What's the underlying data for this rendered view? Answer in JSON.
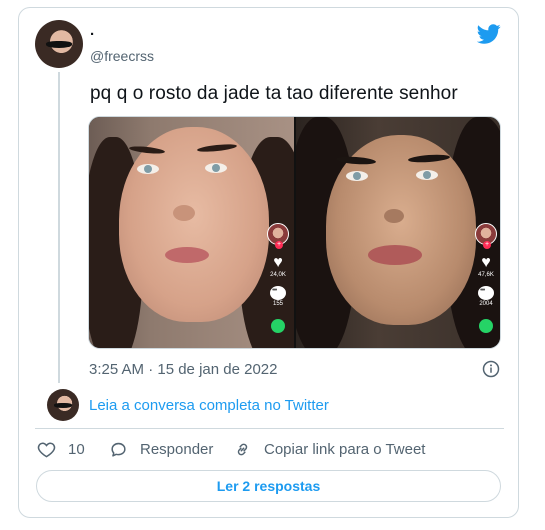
{
  "author": {
    "display_name": ".",
    "handle": "@freecrss"
  },
  "tweet": {
    "text": "pq q o rosto da jade ta tao diferente senhor",
    "timestamp": "3:25 AM · 15 de jan de 2022"
  },
  "media": {
    "left_panel": {
      "likes": "24,0K",
      "comments": "155"
    },
    "right_panel": {
      "likes": "47,6K",
      "comments": "2004"
    }
  },
  "read_conversation": "Leia a conversa completa no Twitter",
  "actions": {
    "like_count": "10",
    "reply_label": "Responder",
    "copy_link_label": "Copiar link para o Tweet"
  },
  "read_replies_button": "Ler 2 respostas",
  "colors": {
    "brand_blue": "#1d9bf0",
    "secondary_text": "#536471",
    "border": "#cfd9de"
  },
  "icons": [
    "twitter-bird-icon",
    "info-icon",
    "heart-icon",
    "reply-bubble-icon",
    "link-icon"
  ]
}
